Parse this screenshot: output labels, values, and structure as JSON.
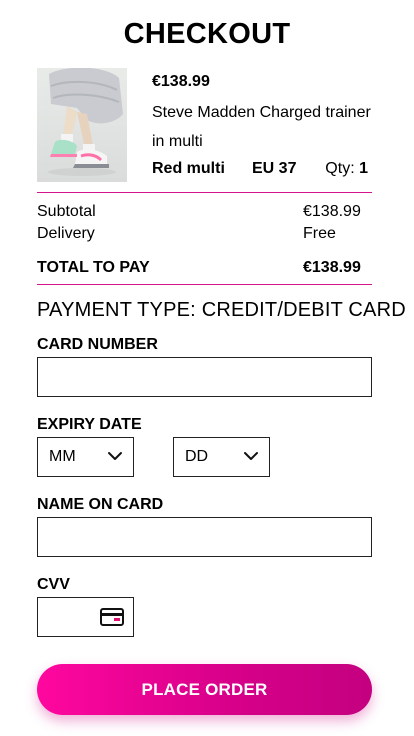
{
  "page": {
    "title": "CHECKOUT"
  },
  "product": {
    "image_icon": "sneaker-product-photo",
    "price": "€138.99",
    "name": "Steve Madden Charged trainer in multi",
    "color": "Red multi",
    "size": "EU 37",
    "qty_label": "Qty:",
    "qty_value": "1"
  },
  "summary": {
    "subtotal_label": "Subtotal",
    "subtotal_value": "€138.99",
    "delivery_label": "Delivery",
    "delivery_value": "Free",
    "total_label": "TOTAL TO PAY",
    "total_value": "€138.99"
  },
  "payment": {
    "type_label": "PAYMENT TYPE: CREDIT/DEBIT CARD",
    "card_number_label": "CARD NUMBER",
    "card_number_value": "",
    "expiry_label": "EXPIRY DATE",
    "expiry_month": "MM",
    "expiry_day": "DD",
    "name_label": "NAME ON CARD",
    "name_value": "",
    "cvv_label": "CVV",
    "cvv_value": ""
  },
  "actions": {
    "place_order": "PLACE ORDER"
  },
  "colors": {
    "accent": "#d4148c",
    "button_start": "#ff079f",
    "button_end": "#c40080"
  }
}
